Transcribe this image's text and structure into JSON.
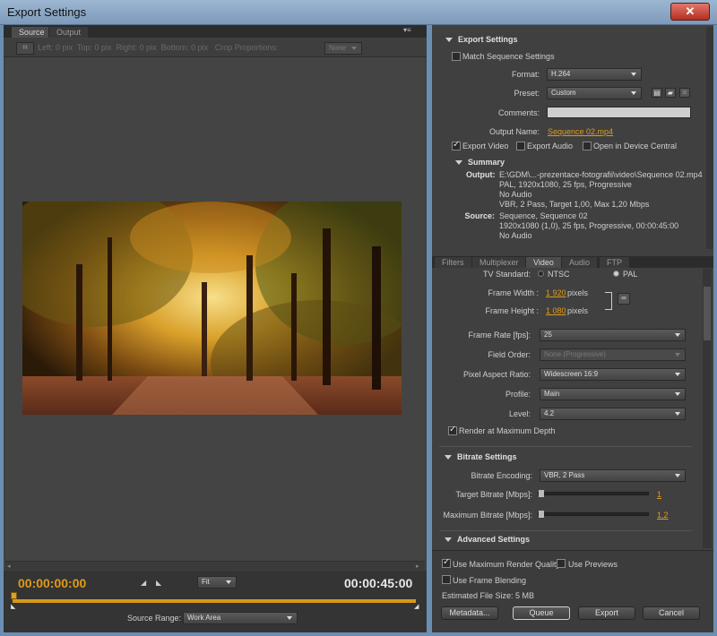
{
  "window": {
    "title": "Export Settings",
    "close": "✕"
  },
  "left": {
    "tabs": [
      "Source",
      "Output"
    ],
    "crop": {
      "left_label": "Left:",
      "left": "0",
      "top_label": "Top:",
      "top": "0",
      "right_label": "Right:",
      "right": "0",
      "bottom_label": "Bottom:",
      "bottom": "0",
      "unit": "pix",
      "proportions_label": "Crop Proportions:",
      "proportions": "None"
    },
    "timeline": {
      "current": "00:00:00:00",
      "duration": "00:00:45:00",
      "zoom": "Fit",
      "source_range_label": "Source Range:",
      "source_range": "Work Area"
    }
  },
  "export_settings": {
    "heading": "Export Settings",
    "match_sequence": "Match Sequence Settings",
    "format_label": "Format:",
    "format": "H.264",
    "preset_label": "Preset:",
    "preset": "Custom",
    "comments_label": "Comments:",
    "comments": "",
    "output_name_label": "Output Name:",
    "output_name": "Sequence 02.mp4",
    "export_video": "Export Video",
    "export_audio": "Export Audio",
    "open_device_central": "Open in Device Central"
  },
  "summary": {
    "heading": "Summary",
    "output_label": "Output:",
    "output_lines": [
      "E:\\GDM\\...-prezentace-fotografii\\video\\Sequence 02.mp4",
      "PAL, 1920x1080, 25 fps, Progressive",
      "No Audio",
      "VBR, 2 Pass, Target 1,00, Max 1,20 Mbps"
    ],
    "source_label": "Source:",
    "source_lines": [
      "Sequence, Sequence 02",
      "1920x1080 (1,0), 25 fps, Progressive, 00:00:45:00",
      "No Audio"
    ]
  },
  "tabs": [
    "Filters",
    "Multiplexer",
    "Video",
    "Audio",
    "FTP"
  ],
  "video": {
    "tv_standard_label": "TV Standard:",
    "ntsc": "NTSC",
    "pal": "PAL",
    "frame_width_label": "Frame Width :",
    "frame_width": "1 920",
    "frame_height_label": "Frame Height :",
    "frame_height": "1 080",
    "unit": "pixels",
    "frame_rate_label": "Frame Rate [fps]:",
    "frame_rate": "25",
    "field_order_label": "Field Order:",
    "field_order": "None (Progressive)",
    "par_label": "Pixel Aspect Ratio:",
    "par": "Widescreen 16:9",
    "profile_label": "Profile:",
    "profile": "Main",
    "level_label": "Level:",
    "level": "4.2",
    "render_max_depth": "Render at Maximum Depth"
  },
  "bitrate": {
    "heading": "Bitrate Settings",
    "encoding_label": "Bitrate Encoding:",
    "encoding": "VBR, 2 Pass",
    "target_label": "Target Bitrate [Mbps]:",
    "target": "1",
    "max_label": "Maximum Bitrate [Mbps]:",
    "max": "1,2"
  },
  "advanced": {
    "heading": "Advanced Settings"
  },
  "bottom": {
    "use_max_quality": "Use Maximum Render Quality",
    "use_previews": "Use Previews",
    "use_frame_blending": "Use Frame Blending",
    "file_size_label": "Estimated File Size:",
    "file_size": "5 MB",
    "metadata": "Metadata...",
    "queue": "Queue",
    "export": "Export",
    "cancel": "Cancel"
  },
  "colors": {
    "accent": "#e09a1a",
    "panel": "#404040"
  }
}
